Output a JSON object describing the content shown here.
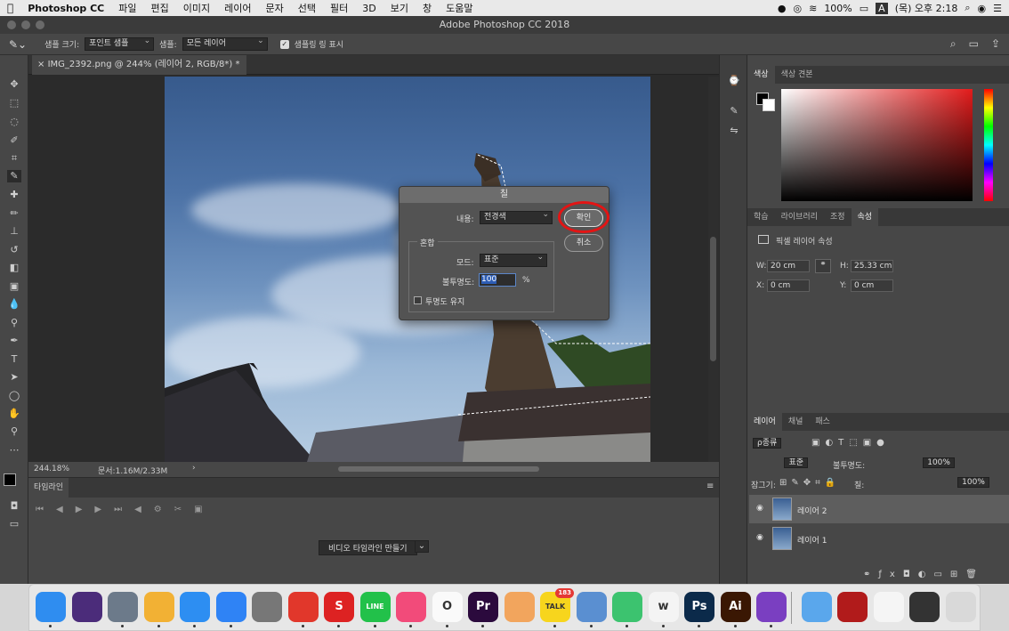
{
  "menubar": {
    "apple": "",
    "app": "Photoshop CC",
    "items": [
      "파일",
      "편집",
      "이미지",
      "레이어",
      "문자",
      "선택",
      "필터",
      "3D",
      "보기",
      "창",
      "도움말"
    ],
    "battery": "100%",
    "input_source": "A",
    "clock": "(목) 오후 2:18"
  },
  "window": {
    "title": "Adobe Photoshop CC 2018"
  },
  "options": {
    "sample_size_label": "샘플 크기:",
    "sample_size_value": "포인트 샘플",
    "sample_label": "샘플:",
    "sample_value": "모든 레이어",
    "show_ring_label": "샘플링 링 표시"
  },
  "document": {
    "tab": "IMG_2392.png @ 244% (레이어 2, RGB/8*) *",
    "zoom": "244.18%",
    "doc_info": "문서:1.16M/2.33M"
  },
  "fill_dialog": {
    "title": "칠",
    "contents_label": "내용:",
    "contents_value": "전경색",
    "blend_group": "혼합",
    "mode_label": "모드:",
    "mode_value": "표준",
    "opacity_label": "불투명도:",
    "opacity_value": "100",
    "opacity_unit": "%",
    "preserve_label": "투명도 유지",
    "ok": "확인",
    "cancel": "취소"
  },
  "color_panel": {
    "tabs": [
      "색상",
      "색상 견본"
    ]
  },
  "props_panel": {
    "tabs": [
      "학습",
      "라이브러리",
      "조정",
      "속성"
    ],
    "header": "픽셀 레이어 속성",
    "w_label": "W:",
    "w_value": "20 cm",
    "h_label": "H:",
    "h_value": "25.33 cm",
    "x_label": "X:",
    "x_value": "0 cm",
    "y_label": "Y:",
    "y_value": "0 cm"
  },
  "layers_panel": {
    "tabs": [
      "레이어",
      "채널",
      "패스"
    ],
    "filter": "ρ종류",
    "blend": "표준",
    "opacity_label": "불투명도:",
    "opacity": "100%",
    "lock_label": "잠그기:",
    "fill_label": "칠:",
    "fill": "100%",
    "layers": [
      {
        "name": "레이어 2",
        "selected": true
      },
      {
        "name": "레이어 1",
        "selected": false
      }
    ]
  },
  "timeline": {
    "tab": "타임라인",
    "create_button": "비디오 타임라인 만들기"
  },
  "dock": {
    "badge": "183",
    "apps": [
      {
        "name": "Finder",
        "color": "#2f8df0"
      },
      {
        "name": "Siri",
        "color": "#4b2c7a"
      },
      {
        "name": "Launchpad",
        "color": "#6c7a8a"
      },
      {
        "name": "Photos",
        "color": "#f2b134"
      },
      {
        "name": "Safari",
        "color": "#2d8ef2"
      },
      {
        "name": "App Store",
        "color": "#2f83f5"
      },
      {
        "name": "System Preferences",
        "color": "#777"
      },
      {
        "name": "Bandicam",
        "color": "#e1372b"
      },
      {
        "name": "Scrivener",
        "color": "#d22"
      },
      {
        "name": "LINE",
        "color": "#22c14a"
      },
      {
        "name": "iTunes",
        "color": "#f24b7a"
      },
      {
        "name": "Opera",
        "color": "#fafafa"
      },
      {
        "name": "Premiere",
        "color": "#2b0a3d"
      },
      {
        "name": "Folx",
        "color": "#f2a55d"
      },
      {
        "name": "KakaoTalk",
        "color": "#f7d51d"
      },
      {
        "name": "Preview",
        "color": "#5a8fd1"
      },
      {
        "name": "Atom",
        "color": "#3cc36f"
      },
      {
        "name": "Wunderlist",
        "color": "#f4f4f4"
      },
      {
        "name": "Photoshop",
        "color": "#0b2a4a"
      },
      {
        "name": "Illustrator",
        "color": "#3a1703"
      },
      {
        "name": "GitHub",
        "color": "#7a3fc1"
      },
      {
        "name": "Downloads",
        "color": "#5aa7ec"
      },
      {
        "name": "Flash",
        "color": "#b11b1b"
      },
      {
        "name": "Document",
        "color": "#f5f5f5"
      },
      {
        "name": "Screen",
        "color": "#333"
      },
      {
        "name": "Trash",
        "color": "#d9d9d9"
      }
    ]
  }
}
